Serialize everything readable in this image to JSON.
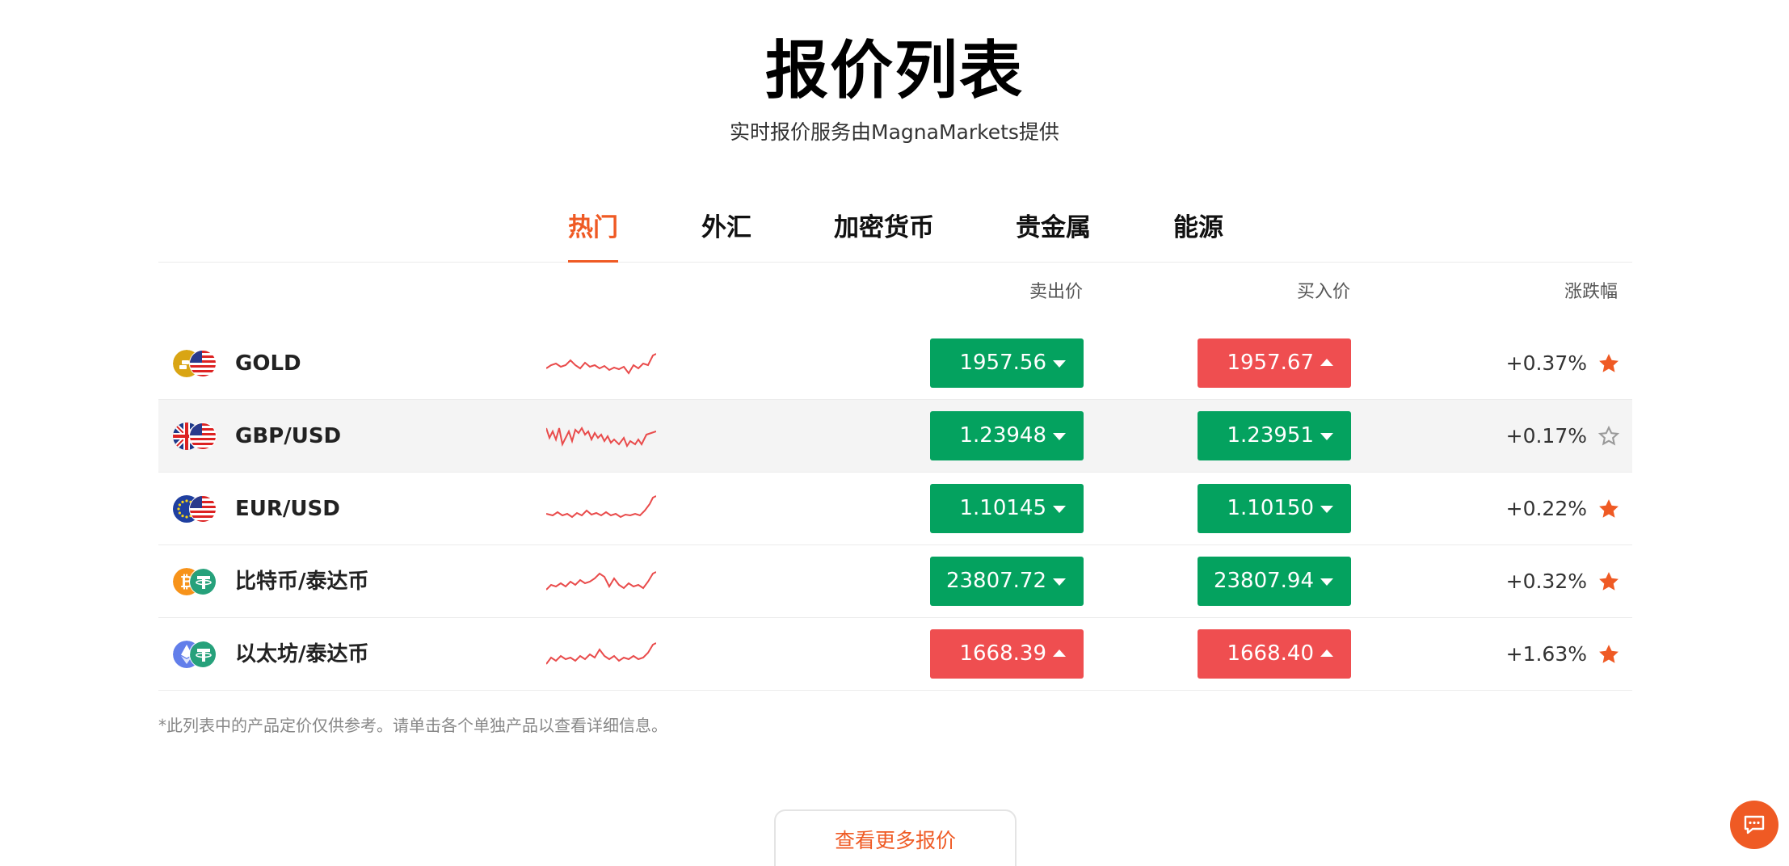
{
  "header": {
    "title": "报价列表",
    "subtitle": "实时报价服务由MagnaMarkets提供"
  },
  "tabs": [
    {
      "label": "热门",
      "active": true
    },
    {
      "label": "外汇",
      "active": false
    },
    {
      "label": "加密货币",
      "active": false
    },
    {
      "label": "贵金属",
      "active": false
    },
    {
      "label": "能源",
      "active": false
    }
  ],
  "columns": {
    "sell": "卖出价",
    "buy": "买入价",
    "change": "涨跌幅"
  },
  "quotes": [
    {
      "symbol": "GOLD",
      "icons": [
        "gold-coin-icon",
        "us-flag-icon"
      ],
      "sell": "1957.56",
      "sell_dir": "down",
      "buy": "1957.67",
      "buy_dir": "up",
      "change": "+0.37%",
      "favorited": true
    },
    {
      "symbol": "GBP/USD",
      "icons": [
        "uk-flag-icon",
        "us-flag-icon"
      ],
      "sell": "1.23948",
      "sell_dir": "down",
      "buy": "1.23951",
      "buy_dir": "down",
      "change": "+0.17%",
      "favorited": false
    },
    {
      "symbol": "EUR/USD",
      "icons": [
        "eu-flag-icon",
        "us-flag-icon"
      ],
      "sell": "1.10145",
      "sell_dir": "down",
      "buy": "1.10150",
      "buy_dir": "down",
      "change": "+0.22%",
      "favorited": true
    },
    {
      "symbol": "比特币/泰达币",
      "icons": [
        "bitcoin-icon",
        "tether-icon"
      ],
      "sell": "23807.72",
      "sell_dir": "down",
      "buy": "23807.94",
      "buy_dir": "down",
      "change": "+0.32%",
      "favorited": true
    },
    {
      "symbol": "以太坊/泰达币",
      "icons": [
        "ethereum-icon",
        "tether-icon"
      ],
      "sell": "1668.39",
      "sell_dir": "up",
      "buy": "1668.40",
      "buy_dir": "up",
      "change": "+1.63%",
      "favorited": true
    }
  ],
  "footnote": "*此列表中的产品定价仅供参考。请单击各个单独产品以查看详细信息。",
  "more_button": "查看更多报价",
  "colors": {
    "accent": "#ef5a24",
    "price_up": "#ef4e50",
    "price_down": "#04a25f",
    "sparkline": "#e94b4b",
    "star_on": "#ef5a24",
    "star_off": "#9a9a9a"
  },
  "icons": {
    "chat": "chat-bubble-icon",
    "favorite": "star-icon",
    "sparkline": "sparkline-chart"
  }
}
